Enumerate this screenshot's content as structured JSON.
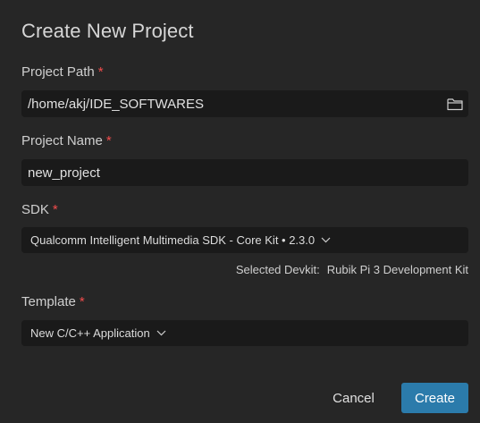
{
  "dialog": {
    "title": "Create New Project"
  },
  "project_path": {
    "label": "Project Path",
    "required_mark": "*",
    "value": "/home/akj/IDE_SOFTWARES",
    "browse_icon": "folder-icon"
  },
  "project_name": {
    "label": "Project Name",
    "required_mark": "*",
    "value": "new_project"
  },
  "sdk": {
    "label": "SDK",
    "required_mark": "*",
    "selected": "Qualcomm Intelligent Multimedia SDK - Core Kit • 2.3.0",
    "dropdown_icon": "chevron-down-icon"
  },
  "devkit": {
    "label": "Selected Devkit:",
    "value": "Rubik Pi 3 Development Kit"
  },
  "template": {
    "label": "Template",
    "required_mark": "*",
    "selected": "New C/C++ Application",
    "dropdown_icon": "chevron-down-icon"
  },
  "actions": {
    "cancel_label": "Cancel",
    "create_label": "Create"
  },
  "colors": {
    "background": "#262626",
    "field_background": "#1a1a1a",
    "required": "#f14c4c",
    "primary_button": "#2b7bab"
  }
}
